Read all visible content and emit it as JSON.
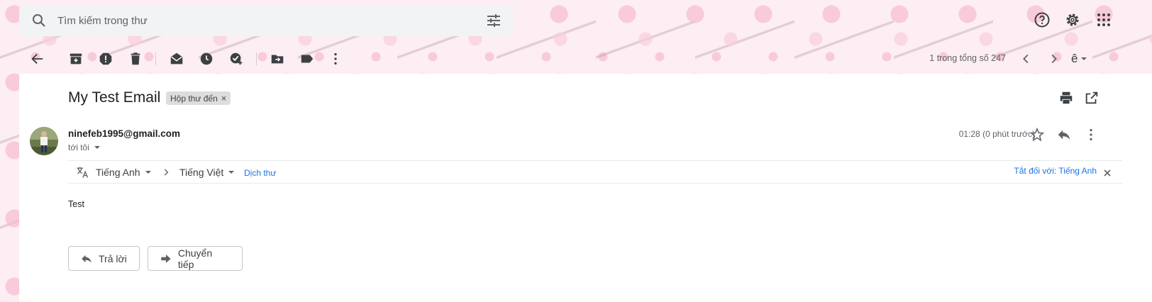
{
  "search": {
    "placeholder": "Tìm kiếm trong thư"
  },
  "toolbar": {
    "pager_text": "1 trong tổng số 247",
    "lang_glyph": "ê"
  },
  "message": {
    "subject": "My Test Email",
    "label_chip": "Hộp thư đến",
    "sender": "ninefeb1995@gmail.com",
    "to_line": "tới tôi",
    "time": "01:28 (0 phút trước)",
    "body": "Test"
  },
  "translate": {
    "from_lang": "Tiếng Anh",
    "to_lang": "Tiếng Việt",
    "translate_link": "Dịch thư",
    "turn_off_link": "Tắt đối với: Tiếng Anh"
  },
  "actions": {
    "reply_label": "Trả lời",
    "forward_label": "Chuyển tiếp"
  },
  "colors": {
    "link": "#1a73e8",
    "icon": "#5f6368",
    "card_bg": "#ffffff",
    "chip_bg": "#dddddd"
  }
}
